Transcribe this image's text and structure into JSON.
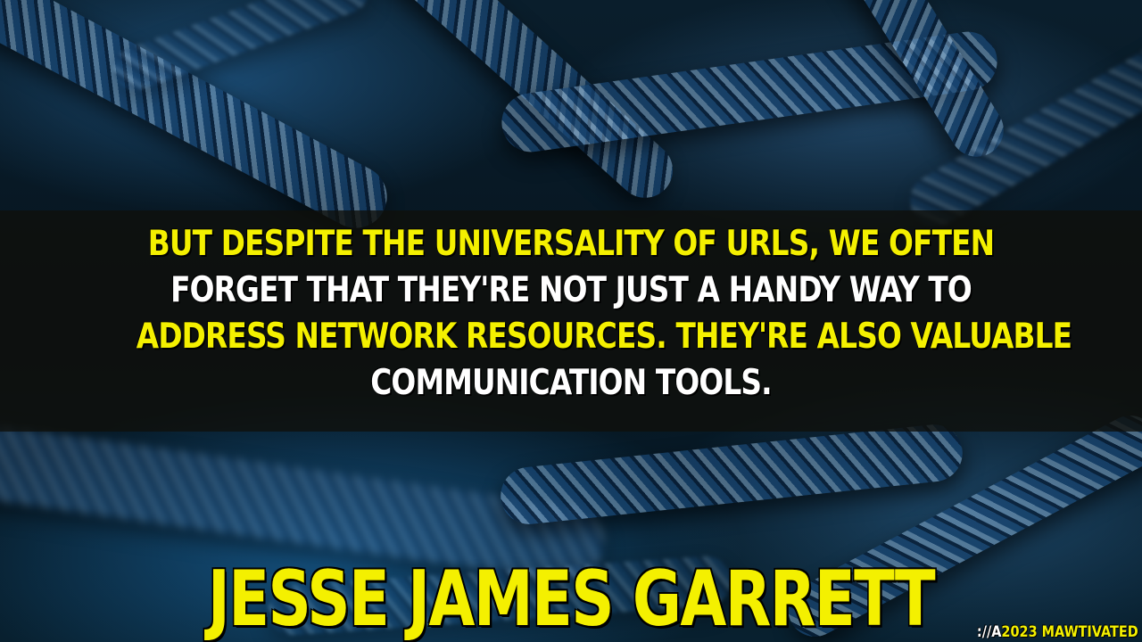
{
  "quote": {
    "lines": [
      {
        "text": "BUT DESPITE THE UNIVERSALITY OF URLS, WE OFTEN",
        "color": "yellow"
      },
      {
        "text": "FORGET THAT THEY'RE NOT JUST A HANDY WAY TO",
        "color": "white"
      },
      {
        "text": "ADDRESS NETWORK RESOURCES. THEY'RE ALSO VALUABLE",
        "color": "yellow"
      },
      {
        "text": "COMMUNICATION TOOLS.",
        "color": "white"
      }
    ]
  },
  "author": "JESSE JAMES GARRETT",
  "watermark": {
    "prefix": "://A",
    "text": "2023 MAWTIVATED"
  },
  "colors": {
    "highlight": "#f4f000",
    "text": "#ffffff",
    "band": "#0f0f0a"
  }
}
